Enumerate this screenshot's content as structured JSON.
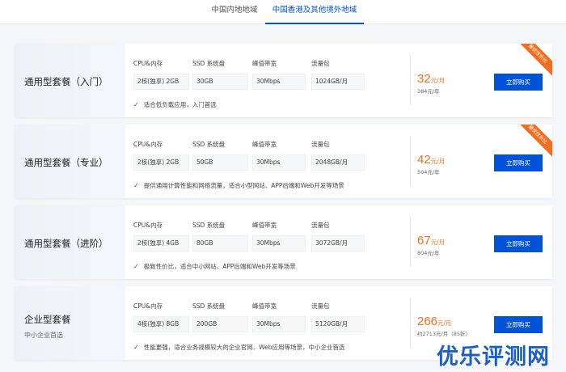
{
  "tabs": [
    {
      "label": "中国内地地域"
    },
    {
      "label": "中国香港及其他境外地域"
    }
  ],
  "spec_headers": [
    "CPU&内存",
    "SSD 系统盘",
    "峰值带宽",
    "流量包"
  ],
  "buy_label": "立即购买",
  "ribbon_label": "最优性价比",
  "plans": [
    {
      "name": "通用型套餐（入门）",
      "specs": [
        "2核(独享) 2GB",
        "30GB",
        "30Mbps",
        "1024GB/月"
      ],
      "feature": "适合低负载应用，入门首选",
      "price": "32",
      "price_unit": "元/月",
      "yearly": "384元/年"
    },
    {
      "name": "通用型套餐（专业）",
      "specs": [
        "2核(独享) 2GB",
        "50GB",
        "30Mbps",
        "2048GB/月"
      ],
      "feature": "提供通用计算性能和网络流量，适合小型网站、APP后端和Web开发等场景",
      "price": "42",
      "price_unit": "元/月",
      "yearly": "504元/年"
    },
    {
      "name": "通用型套餐（进阶）",
      "specs": [
        "2核(独享) 4GB",
        "80GB",
        "30Mbps",
        "3072GB/月"
      ],
      "feature": "极致性价比，适合中小网站、APP后端和Web开发等场景",
      "price": "67",
      "price_unit": "元/月",
      "yearly": "804元/年"
    },
    {
      "name": "企业型套餐",
      "subtitle": "中小企业首选",
      "specs": [
        "4核(独享) 8GB",
        "200GB",
        "30Mbps",
        "5120GB/月"
      ],
      "feature": "性能更强，适合业务规模较大的企业官网、Web应用等场景，中小企业首选",
      "price": "266",
      "price_unit": "元/月",
      "yearly": "约2713元/月（85折）"
    }
  ],
  "watermark": "优乐评测网",
  "colors": {
    "accent": "#0052d9",
    "price": "#f26d1f",
    "ribbon": "#f26d1f"
  }
}
